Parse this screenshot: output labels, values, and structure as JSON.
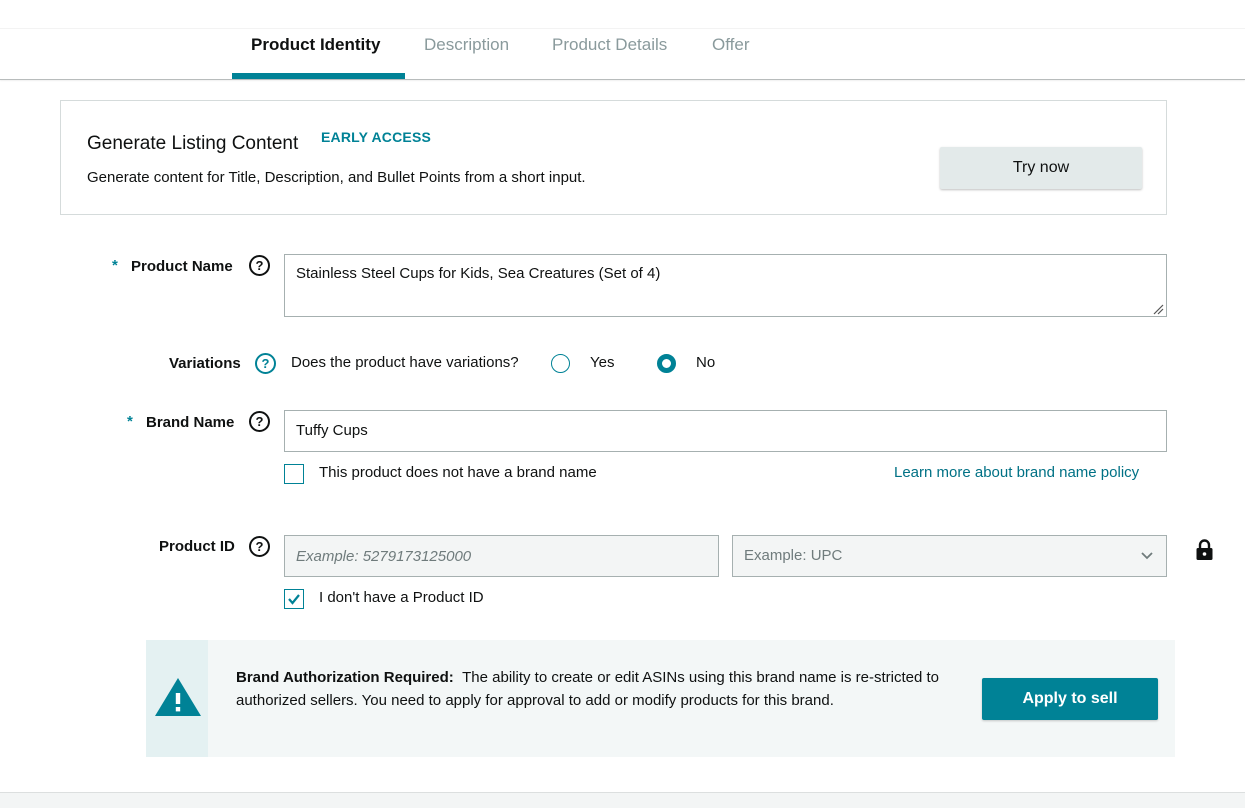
{
  "tabs": [
    {
      "label": "Product Identity",
      "active": true
    },
    {
      "label": "Description",
      "active": false
    },
    {
      "label": "Product Details",
      "active": false
    },
    {
      "label": "Offer",
      "active": false
    }
  ],
  "generate": {
    "title": "Generate Listing Content",
    "badge": "EARLY ACCESS",
    "description": "Generate content for Title, Description, and Bullet Points from a short input.",
    "button_label": "Try now"
  },
  "product_name": {
    "required_marker": "*",
    "label": "Product Name",
    "help_icon": "question-circle-icon",
    "value": "Stainless Steel Cups for Kids, Sea Creatures (Set of 4)"
  },
  "variations": {
    "label": "Variations",
    "help_icon": "question-circle-icon",
    "question": "Does the product have variations?",
    "options": [
      {
        "label": "Yes",
        "selected": false
      },
      {
        "label": "No",
        "selected": true
      }
    ]
  },
  "brand_name": {
    "required_marker": "*",
    "label": "Brand Name",
    "help_icon": "question-circle-icon",
    "value": "Tuffy Cups",
    "no_brand_checkbox_label": "This product does not have a brand name",
    "no_brand_checked": false,
    "policy_link": "Learn more about brand name policy"
  },
  "product_id": {
    "label": "Product ID",
    "help_icon": "question-circle-icon",
    "id_placeholder": "Example: 5279173125000",
    "type_placeholder": "Example: UPC",
    "no_id_checkbox_label": "I don't have a Product ID",
    "no_id_checked": true,
    "lock_icon": "lock-icon"
  },
  "alert": {
    "icon": "warning-triangle-icon",
    "title": "Brand Authorization Required:",
    "message": "The ability to create or edit ASINs using this brand name is re-stricted to authorized sellers. You need to apply for approval to add or modify products for this brand.",
    "button_label": "Apply to sell"
  },
  "colors": {
    "accent": "#008296",
    "link": "#007185",
    "text": "#0f1111",
    "inactive_tab": "#8a9a9c"
  }
}
